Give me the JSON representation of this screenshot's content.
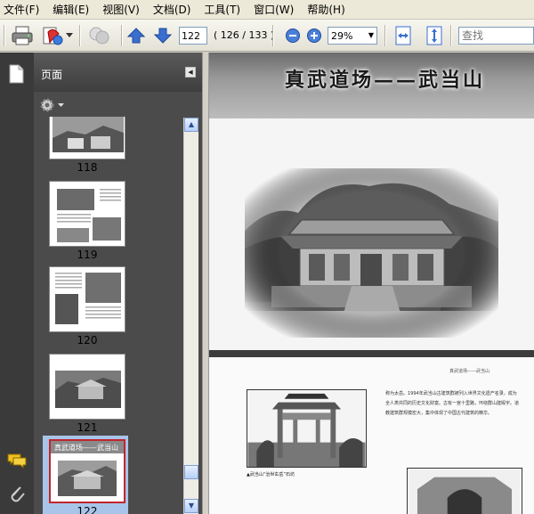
{
  "menu": {
    "items": [
      "文件(F)",
      "编辑(E)",
      "视图(V)",
      "文档(D)",
      "工具(T)",
      "窗口(W)",
      "帮助(H)"
    ]
  },
  "toolbar": {
    "current_page": "122",
    "page_count": "( 126 / 133 )",
    "zoom": "29%",
    "search_placeholder": "查找"
  },
  "panel": {
    "title": "页面",
    "thumbnails": [
      {
        "label": "118"
      },
      {
        "label": "119"
      },
      {
        "label": "120"
      },
      {
        "label": "121"
      },
      {
        "label": "122",
        "mini_title": "真武道场——武当山",
        "selected": true
      }
    ]
  },
  "document": {
    "page1_title": "真武道场——武当山",
    "page2": {
      "running_header": "真武道场——武当山",
      "caption": "▲武当山“治世玄岳”石坊",
      "text": "称为太岳。1994年武当山古建筑群被列入世界文化遗产名录，成为全人类共同的历史文化财富。古有一宫十里路，环绕群山建殿宇。道教建筑群规模宏大，集中体现了中国古代建筑的精华。"
    }
  },
  "colors": {
    "accent_blue": "#3a6fcf",
    "selection": "#a8c4e8",
    "selection_border": "#c0262c",
    "panel_bg": "#4b4b4b"
  }
}
